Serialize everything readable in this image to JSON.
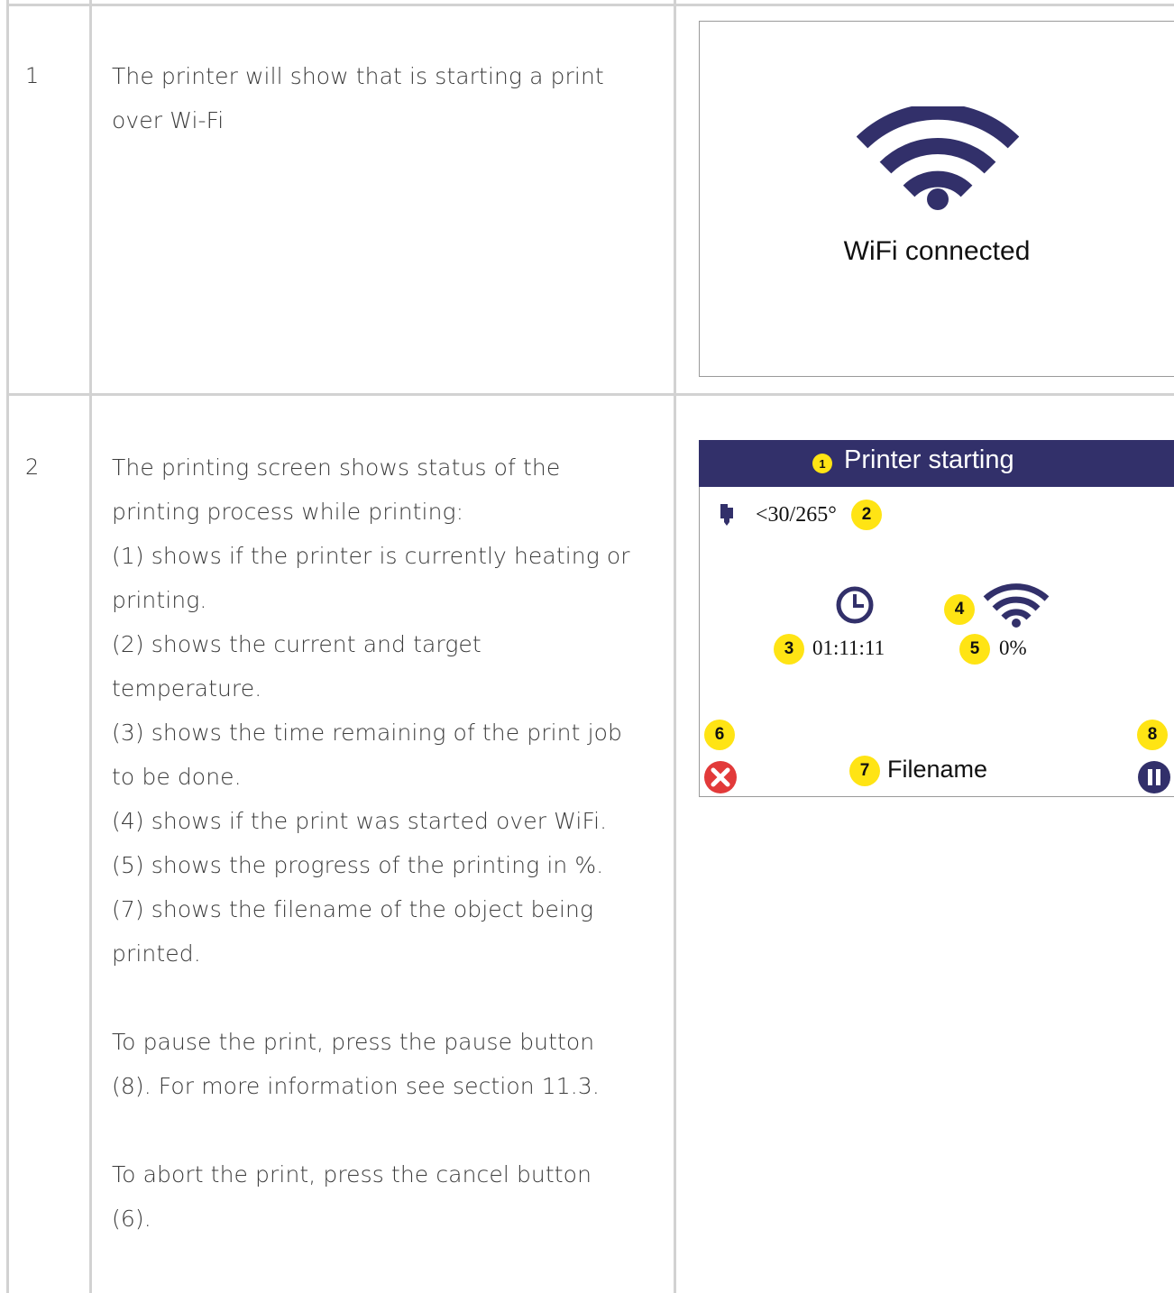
{
  "rows": [
    {
      "number": "1",
      "description_lines": [
        "The printer will show that is starting a print",
        "over Wi-Fi"
      ],
      "screen": {
        "label": "WiFi connected",
        "icon": "wifi-icon",
        "wifi_color": "#32306a"
      }
    },
    {
      "number": "2",
      "description_lines": [
        "The printing screen shows status of the",
        "printing process while printing:",
        "(1) shows if the printer is currently heating or",
        "printing.",
        "(2) shows the current and target",
        "temperature.",
        "(3) shows the time remaining of the print job",
        "to be done.",
        "(4) shows if the print was started over WiFi.",
        "(5) shows the progress of the printing in %.",
        "(7) shows the filename of the object being",
        "printed."
      ],
      "pause_lines": [
        "To pause the print, press the pause button",
        "(8). For more information see section 11.3."
      ],
      "abort_lines": [
        "To abort the print, press the cancel button",
        "(6)."
      ],
      "screen": {
        "title": "Printer starting",
        "temperature": "<30/265°",
        "time_remaining": "01:11:11",
        "progress": "0%",
        "filename": "Filename",
        "badges": [
          "1",
          "2",
          "3",
          "4",
          "5",
          "6",
          "7",
          "8"
        ],
        "icons": [
          "nozzle-icon",
          "clock-icon",
          "wifi-icon",
          "cancel-icon",
          "pause-icon"
        ],
        "title_bar_color": "#32306a",
        "badge_color": "#ffe414",
        "cancel_color": "#e23a3a"
      }
    }
  ]
}
